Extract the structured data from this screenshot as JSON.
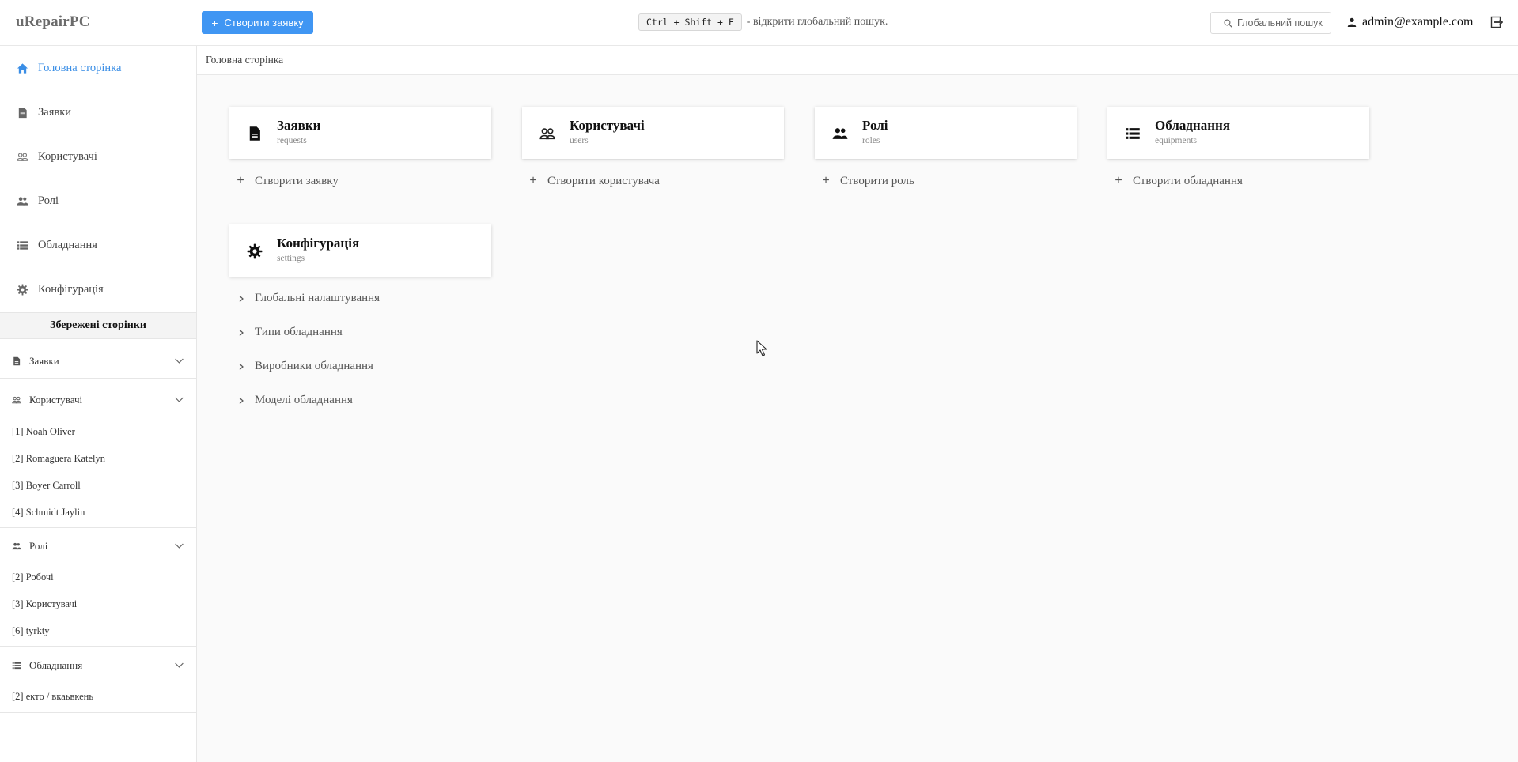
{
  "header": {
    "brand": "uRepairPC",
    "create_button": "Створити заявку",
    "shortcut_key": "Ctrl + Shift + F",
    "shortcut_hint": "- відкрити глобальний пошук.",
    "global_search": "Глобальний пошук",
    "user_email": "admin@example.com",
    "accent_color": "#4096f3"
  },
  "breadcrumb": "Головна сторінка",
  "sidebar": {
    "items": [
      {
        "label": "Головна сторінка",
        "icon": "home-icon"
      },
      {
        "label": "Заявки",
        "icon": "document-icon"
      },
      {
        "label": "Користувачі",
        "icon": "users-icon"
      },
      {
        "label": "Ролі",
        "icon": "people-icon"
      },
      {
        "label": "Обладнання",
        "icon": "list-icon"
      },
      {
        "label": "Конфігурація",
        "icon": "gear-icon"
      }
    ],
    "saved_title": "Збережені сторінки",
    "saved_groups": [
      {
        "label": "Заявки",
        "items": []
      },
      {
        "label": "Користувачі",
        "items": [
          "[1] Noah Oliver",
          "[2] Romaguera Katelyn",
          "[3] Boyer Carroll",
          "[4] Schmidt Jaylin"
        ]
      },
      {
        "label": "Ролі",
        "items": [
          "[2] Робочі",
          "[3] Користувачі",
          "[6] tyrkty"
        ]
      },
      {
        "label": "Обладнання",
        "items": [
          "[2] екто / вкаьвкень"
        ]
      }
    ]
  },
  "cards": [
    {
      "title": "Заявки",
      "subtitle": "requests",
      "action": "Створити заявку"
    },
    {
      "title": "Користувачі",
      "subtitle": "users",
      "action": "Створити користувача"
    },
    {
      "title": "Ролі",
      "subtitle": "roles",
      "action": "Створити роль"
    },
    {
      "title": "Обладнання",
      "subtitle": "equipments",
      "action": "Створити обладнання"
    }
  ],
  "config": {
    "title": "Конфігурація",
    "subtitle": "settings",
    "links": [
      "Глобальні налаштування",
      "Типи обладнання",
      "Виробники обладнання",
      "Моделі обладнання"
    ]
  }
}
